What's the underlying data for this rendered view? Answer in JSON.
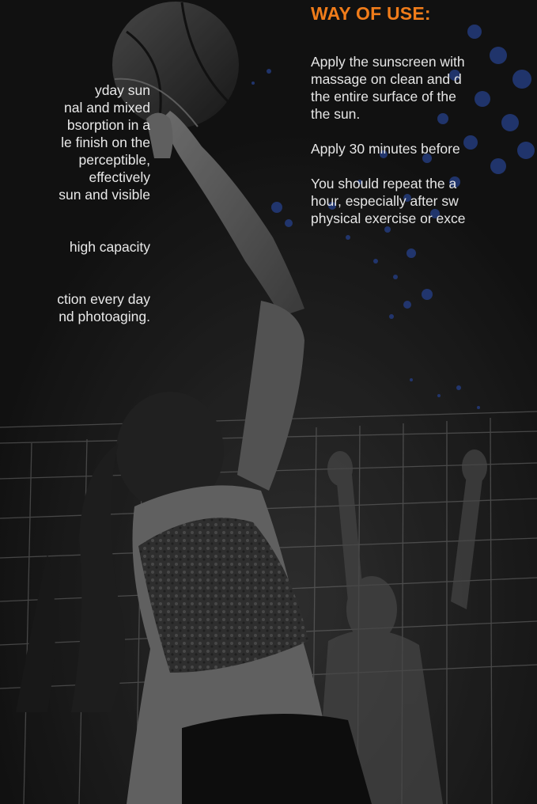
{
  "left_column": {
    "paragraph_1": [
      "yday sun",
      "nal and mixed",
      "bsorption in a",
      "le finish on the",
      "perceptible,",
      "effectively",
      "sun and visible"
    ],
    "paragraph_2": [
      "high capacity"
    ],
    "paragraph_3": [
      "ction every day",
      "nd photoaging."
    ]
  },
  "right_column": {
    "heading": "WAY OF USE:",
    "paragraph_1": [
      "Apply the sunscreen with",
      "massage on clean and d",
      "the entire surface of the",
      "the sun."
    ],
    "paragraph_2": [
      "Apply 30 minutes before"
    ],
    "paragraph_3": [
      "You should repeat the a",
      "hour, especially after sw",
      "physical exercise or exce"
    ]
  },
  "colors": {
    "heading": "#f07c1a",
    "text": "#e6e6e6",
    "background": "#1f1f1f",
    "dots": "#2f4fa8"
  },
  "photo": {
    "subject": "volleyball-player-spiking",
    "treatment": "monochrome"
  }
}
